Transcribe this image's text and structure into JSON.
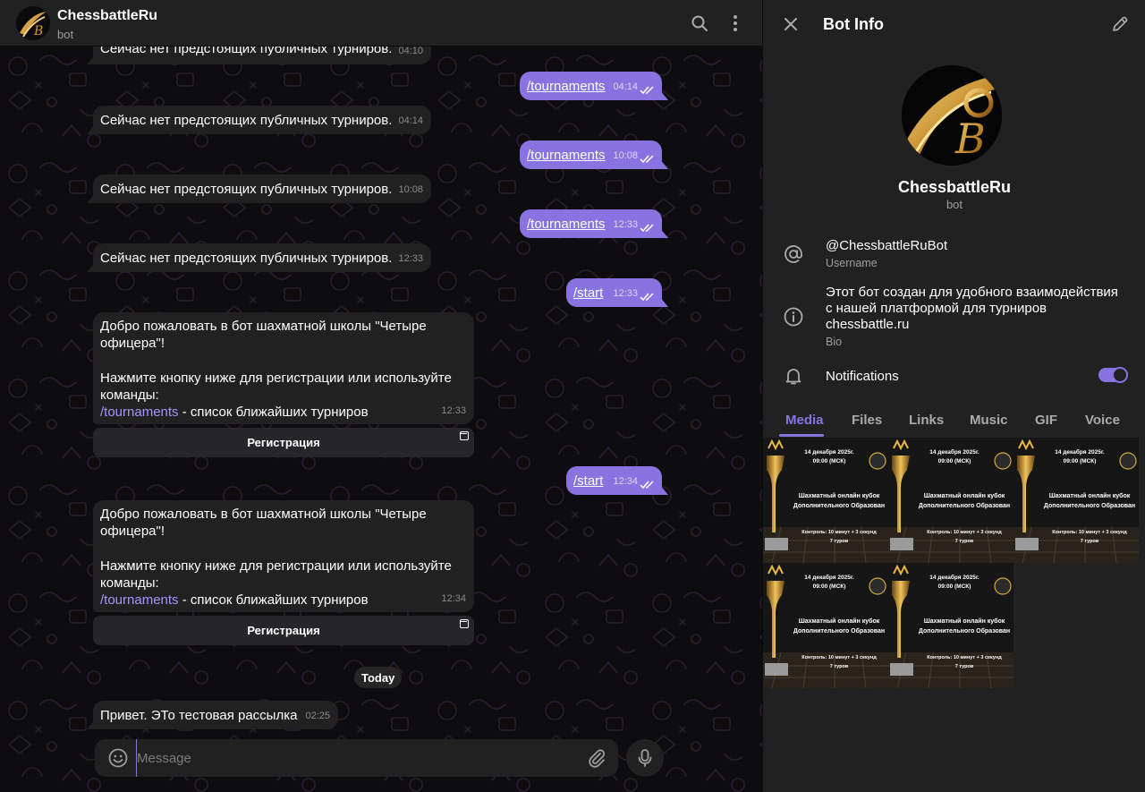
{
  "chat": {
    "title": "ChessbattleRu",
    "subtitle": "bot",
    "messages": [
      {
        "dir": "in",
        "text": "Сейчас нет предстоящих публичных турниров.",
        "time": "04:10"
      },
      {
        "dir": "out",
        "text": "/tournaments",
        "time": "04:14"
      },
      {
        "dir": "in",
        "text": "Сейчас нет предстоящих публичных турниров.",
        "time": "04:14"
      },
      {
        "dir": "out",
        "text": "/tournaments",
        "time": "10:08"
      },
      {
        "dir": "in",
        "text": "Сейчас нет предстоящих публичных турниров.",
        "time": "10:08"
      },
      {
        "dir": "out",
        "text": "/tournaments",
        "time": "12:33"
      },
      {
        "dir": "in",
        "text": "Сейчас нет предстоящих публичных турниров.",
        "time": "12:33"
      },
      {
        "dir": "out",
        "text": "/start",
        "time": "12:33"
      },
      {
        "dir": "in",
        "line1": "Добро пожаловать в бот шахматной школы \"Четыре",
        "line2": "офицера\"!",
        "line3": "Нажмите кнопку ниже для регистрации или используйте",
        "line4": "команды:",
        "link": "/tournaments",
        "rest": " - список ближайших турниров",
        "time": "12:33",
        "button": "Регистрация"
      },
      {
        "dir": "out",
        "text": "/start",
        "time": "12:34"
      },
      {
        "dir": "in",
        "line1": "Добро пожаловать в бот шахматной школы \"Четыре",
        "line2": "офицера\"!",
        "line3": "Нажмите кнопку ниже для регистрации или используйте",
        "line4": "команды:",
        "link": "/tournaments",
        "rest": " - список ближайших турниров",
        "time": "12:34",
        "button": "Регистрация"
      },
      {
        "dir": "in",
        "text": "Привет. ЭТо тестовая рассылка",
        "time": "02:25"
      }
    ],
    "date_separator": "Today",
    "composer": {
      "placeholder": "Message"
    }
  },
  "info": {
    "title": "Bot Info",
    "name": "ChessbattleRu",
    "subtitle": "bot",
    "username": "@ChessbattleRuBot",
    "username_label": "Username",
    "bio_line1": "Этот бот создан для удобного взаимодействия",
    "bio_line2": "с нашей платформой для турниров",
    "bio_line3": "chessbattle.ru",
    "bio_label": "Bio",
    "notifications_label": "Notifications",
    "notifications_on": true,
    "tabs": [
      "Media",
      "Files",
      "Links",
      "Music",
      "GIF",
      "Voice"
    ],
    "active_tab": "Media",
    "media_card": {
      "date": "14 декабря 2025г.",
      "time": "09:00 (МСК)",
      "title1": "Шахматный онлайн кубок",
      "title2": "Дополнительного Образован",
      "control": "Контроль: 10 минут + 3 секунд",
      "rounds": "7 туров"
    }
  },
  "colors": {
    "accent": "#8774e1",
    "panel": "#212121",
    "chat_bg": "#0d0d0f",
    "link": "#a695ff"
  }
}
